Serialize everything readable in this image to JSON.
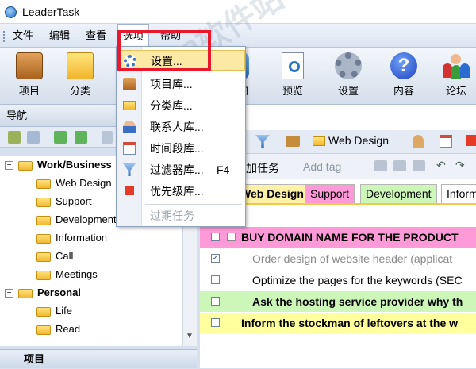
{
  "app": {
    "title": "LeaderTask"
  },
  "menu": {
    "items": [
      "文件",
      "编辑",
      "查看",
      "选项",
      "帮助"
    ]
  },
  "toolbar": {
    "buttons": [
      "项目",
      "分类",
      "",
      "",
      "加",
      "预览",
      "设置",
      "内容",
      "论坛"
    ]
  },
  "nav": {
    "title": "导航",
    "bottom_label": "项目"
  },
  "tree": {
    "items": [
      {
        "label": "Work/Business",
        "level": 0,
        "bold": true
      },
      {
        "label": "Web Design",
        "level": 1
      },
      {
        "label": "Support",
        "level": 1
      },
      {
        "label": "Development",
        "level": 1
      },
      {
        "label": "Information",
        "level": 1
      },
      {
        "label": "Call",
        "level": 1
      },
      {
        "label": "Meetings",
        "level": 1
      },
      {
        "label": "Personal",
        "level": 0,
        "bold": true
      },
      {
        "label": "Life",
        "level": 1
      },
      {
        "label": "Read",
        "level": 1
      }
    ]
  },
  "dropdown": {
    "items": [
      "设置...",
      "项目库...",
      "分类库...",
      "联系人库...",
      "时间段库...",
      "过滤器库...",
      "优先级库...",
      "过期任务"
    ],
    "shortcut_filter": "F4"
  },
  "main_toolbar": {
    "category_filter": "Web Design",
    "add_task": "加任务",
    "add_tag": "Add tag"
  },
  "tabs": [
    "Web Design",
    "Support",
    "Development",
    "Inform"
  ],
  "tasks": [
    {
      "text": "BUY DOMAIN NAME FOR THE PRODUCT",
      "bold": true,
      "bg": "#ff9ad9",
      "checked": false,
      "done": false
    },
    {
      "text": "Order design of website header (applicat",
      "bold": false,
      "bg": "#ffffff",
      "checked": true,
      "done": true
    },
    {
      "text": "Optimize the pages for the keywords (SEC",
      "bold": false,
      "bg": "#ffffff",
      "checked": false,
      "done": false
    },
    {
      "text": "Ask the hosting service provider why th",
      "bold": true,
      "bg": "#ccf7b8",
      "checked": false,
      "done": false
    },
    {
      "text": "Inform the stockman of leftovers at the w",
      "bold": true,
      "bg": "#ffff9e",
      "checked": false,
      "done": false
    }
  ],
  "watermark": "3322软件站",
  "colors": {
    "highlight": "#e8192c",
    "tab_support": "#ff9ad9",
    "tab_development": "#ccf7b8",
    "tab_web": "#fff2a8"
  }
}
